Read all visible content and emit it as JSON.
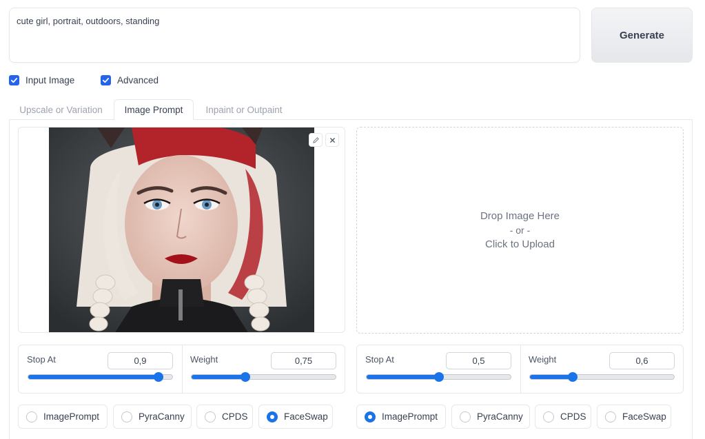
{
  "prompt": {
    "value": "cute girl, portrait, outdoors, standing"
  },
  "generate_button": {
    "label": "Generate"
  },
  "checkboxes": [
    {
      "label": "Input Image",
      "checked": true
    },
    {
      "label": "Advanced",
      "checked": true
    }
  ],
  "tabs": [
    {
      "label": "Upscale or Variation",
      "active": false
    },
    {
      "label": "Image Prompt",
      "active": true
    },
    {
      "label": "Inpaint or Outpaint",
      "active": false
    }
  ],
  "image_slot_1": {
    "image_description_icon": "portrait-image",
    "tools": [
      "edit-icon",
      "close-icon"
    ]
  },
  "image_slot_2": {
    "line1": "Drop Image Here",
    "line2": "- or -",
    "line3": "Click to Upload"
  },
  "controls": [
    {
      "stop_at": {
        "label": "Stop At",
        "value": "0,9",
        "fraction": 0.9
      },
      "weight": {
        "label": "Weight",
        "value": "0,75",
        "fraction": 0.375
      },
      "types": [
        {
          "label": "ImagePrompt",
          "selected": false
        },
        {
          "label": "PyraCanny",
          "selected": false
        },
        {
          "label": "CPDS",
          "selected": false
        },
        {
          "label": "FaceSwap",
          "selected": true
        }
      ]
    },
    {
      "stop_at": {
        "label": "Stop At",
        "value": "0,5",
        "fraction": 0.5
      },
      "weight": {
        "label": "Weight",
        "value": "0,6",
        "fraction": 0.3
      },
      "types": [
        {
          "label": "ImagePrompt",
          "selected": true
        },
        {
          "label": "PyraCanny",
          "selected": false
        },
        {
          "label": "CPDS",
          "selected": false
        },
        {
          "label": "FaceSwap",
          "selected": false
        }
      ]
    }
  ],
  "colors": {
    "accent": "#1a73e8",
    "check_bg": "#2563eb"
  }
}
